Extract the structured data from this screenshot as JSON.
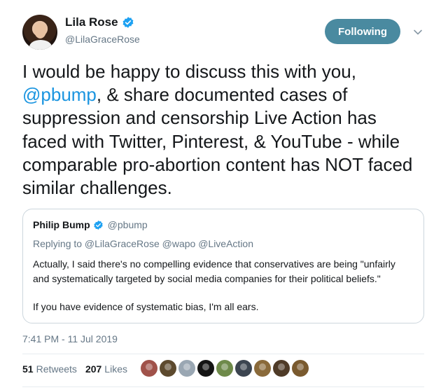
{
  "author": {
    "name": "Lila Rose",
    "handle": "@LilaGraceRose",
    "verified": true
  },
  "follow_button": {
    "label": "Following"
  },
  "tweet": {
    "text_before": "I would be happy to discuss this with you, ",
    "mention": "@pbump",
    "text_after": ", & share documented cases of suppression and censorship Live Action has faced with Twitter, Pinterest, & YouTube - while comparable pro-abortion content has NOT faced similar challenges."
  },
  "quoted_tweet": {
    "name": "Philip Bump",
    "handle": "@pbump",
    "verified": true,
    "replying_to": "Replying to @LilaGraceRose @wapo @LiveAction",
    "body": "Actually, I said there's no compelling evidence that conservatives are being \"unfairly and systematically targeted by social media companies for their political beliefs.\"",
    "body2": "If you have evidence of systematic bias, I'm all ears."
  },
  "timestamp": "7:41 PM - 11 Jul 2019",
  "stats": {
    "retweets_count": "51",
    "retweets_label": "Retweets",
    "likes_count": "207",
    "likes_label": "Likes"
  },
  "colors": {
    "accent": "#1b95e0",
    "follow_button_bg": "#4a8aa0",
    "muted_text": "#657786"
  },
  "likers": [
    {
      "color": "#a0524a"
    },
    {
      "color": "#5d4a2e"
    },
    {
      "color": "#9aa7b3"
    },
    {
      "color": "#141414"
    },
    {
      "color": "#6e8a4a"
    },
    {
      "color": "#3c4550"
    },
    {
      "color": "#8a6a3a"
    },
    {
      "color": "#4f3b28"
    },
    {
      "color": "#7a5a2e"
    }
  ]
}
